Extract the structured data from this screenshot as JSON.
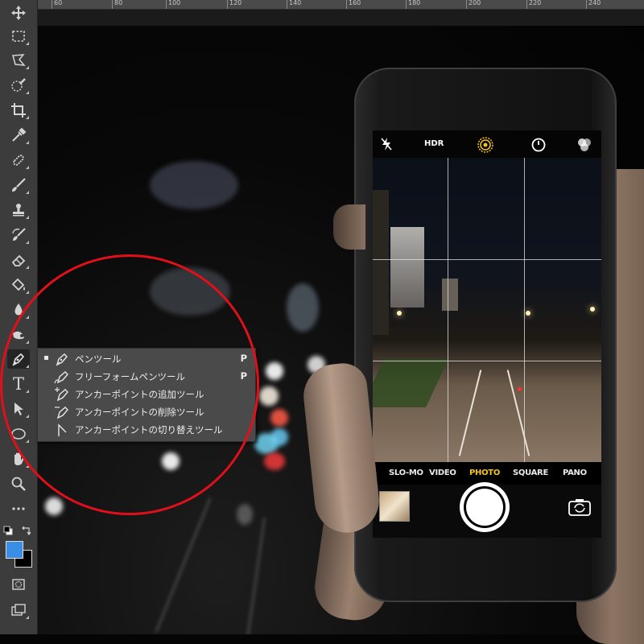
{
  "ruler": {
    "labels": [
      "60",
      "80",
      "100",
      "120",
      "140",
      "160",
      "180",
      "200",
      "220",
      "240"
    ]
  },
  "toolbar": {
    "tools": [
      "move-icon",
      "marquee-icon",
      "lasso-icon",
      "quick-selection-icon",
      "crop-icon",
      "eyedropper-icon",
      "healing-brush-icon",
      "brush-icon",
      "clone-stamp-icon",
      "history-brush-icon",
      "eraser-icon",
      "paint-bucket-icon",
      "blur-icon",
      "dodge-icon",
      "pen-icon",
      "type-icon",
      "path-selection-icon",
      "ellipse-icon",
      "hand-icon",
      "zoom-icon",
      "more-tools-icon",
      "swap-colors-icon",
      "quick-mask-icon",
      "screen-mode-icon"
    ],
    "active_tool": "pen-icon",
    "type_glyph": "T",
    "foreground_color": "#3a8ee6",
    "background_color": "#000000"
  },
  "flyout": {
    "items": [
      {
        "label": "ペンツール",
        "shortcut": "P",
        "selected": true
      },
      {
        "label": "フリーフォームペンツール",
        "shortcut": "P",
        "selected": false
      },
      {
        "label": "アンカーポイントの追加ツール",
        "shortcut": "",
        "selected": false
      },
      {
        "label": "アンカーポイントの削除ツール",
        "shortcut": "",
        "selected": false
      },
      {
        "label": "アンカーポイントの切り替えツール",
        "shortcut": "",
        "selected": false
      }
    ]
  },
  "camera": {
    "top_controls": [
      "flash-off-icon",
      "hdr-icon",
      "live-photo-icon",
      "timer-icon",
      "filters-icon"
    ],
    "hdr_label": "HDR",
    "modes": [
      "SLO-MO",
      "VIDEO",
      "PHOTO",
      "SQUARE",
      "PANO"
    ],
    "active_mode": "PHOTO"
  },
  "annotation": {
    "color": "#e0101a"
  }
}
